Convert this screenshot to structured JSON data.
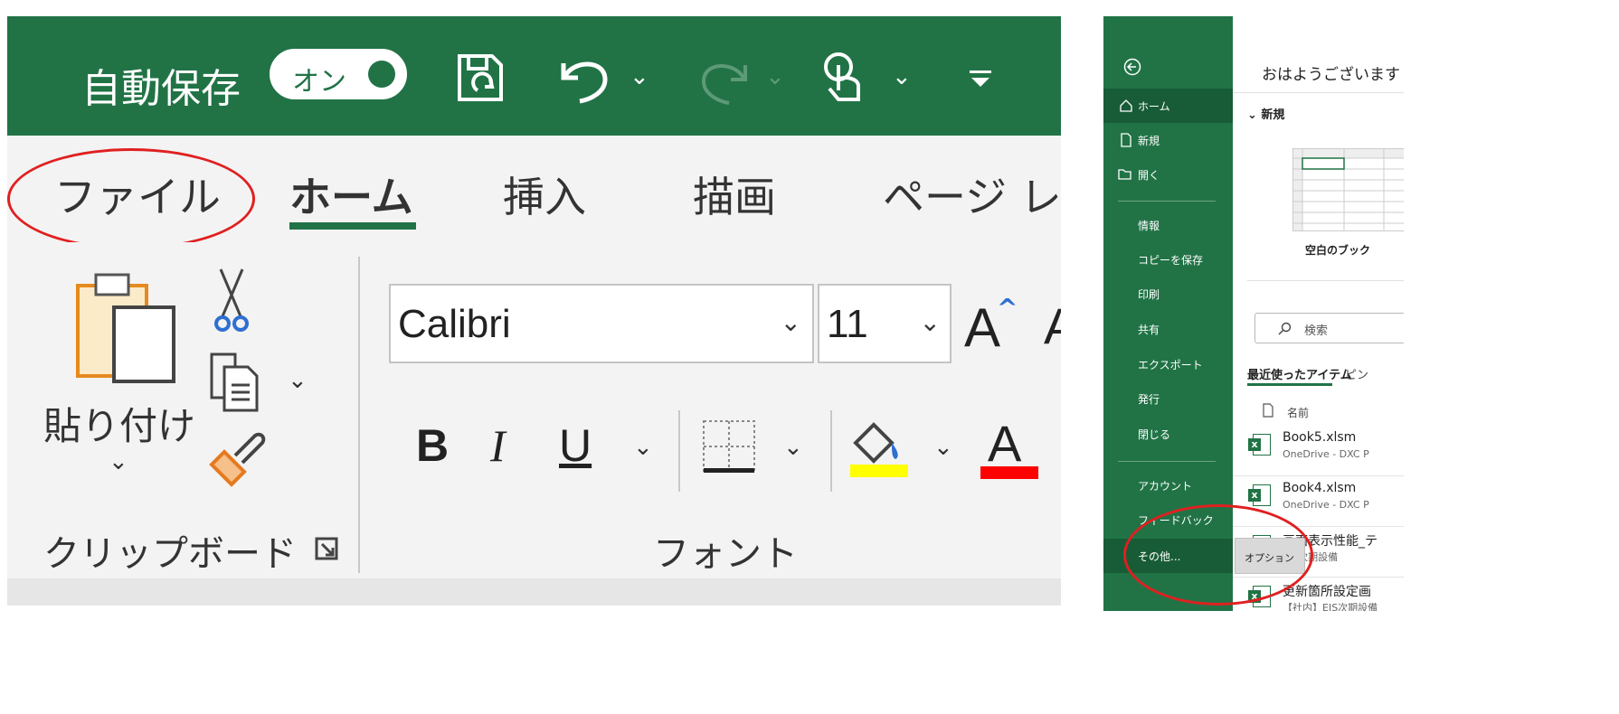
{
  "ribbon": {
    "autosave_label": "自動保存",
    "autosave_state": "オン",
    "tabs": {
      "file": "ファイル",
      "home": "ホーム",
      "insert": "挿入",
      "draw": "描画",
      "page_layout": "ページ レ"
    },
    "clipboard": {
      "paste_label": "貼り付け",
      "group_label": "クリップボード"
    },
    "font": {
      "name": "Calibri",
      "size": "11",
      "grow": "A",
      "bold": "B",
      "italic": "I",
      "underline": "U",
      "font_color": "A",
      "group_label": "フォント"
    },
    "colors": {
      "titlebar": "#217346",
      "highlight": "#ffff00",
      "font_color": "#ff0000",
      "annotation": "#e02020"
    }
  },
  "backstage": {
    "nav": {
      "home": "ホーム",
      "new": "新規",
      "open": "開く",
      "info": "情報",
      "save_copy": "コピーを保存",
      "print": "印刷",
      "share": "共有",
      "export": "エクスポート",
      "publish": "発行",
      "close": "閉じる",
      "account": "アカウント",
      "feedback": "フィードバック",
      "more": "その他..."
    },
    "greeting": "おはようございます",
    "new_section": "新規",
    "blank_workbook": "空白のブック",
    "search_placeholder": "検索",
    "recent_tab": "最近使ったアイテム",
    "pinned_tab": "ピン",
    "name_header": "名前",
    "files": [
      {
        "name": "Book5.xlsm",
        "location": "OneDrive - DXC P"
      },
      {
        "name": "Book4.xlsm",
        "location": "OneDrive - DXC P"
      },
      {
        "name": "画面表示性能_テ",
        "location": "EIS次期設備"
      },
      {
        "name": "更新箇所設定画",
        "location": "【社内】EIS次期設備"
      }
    ],
    "options_popup": "オプション"
  }
}
